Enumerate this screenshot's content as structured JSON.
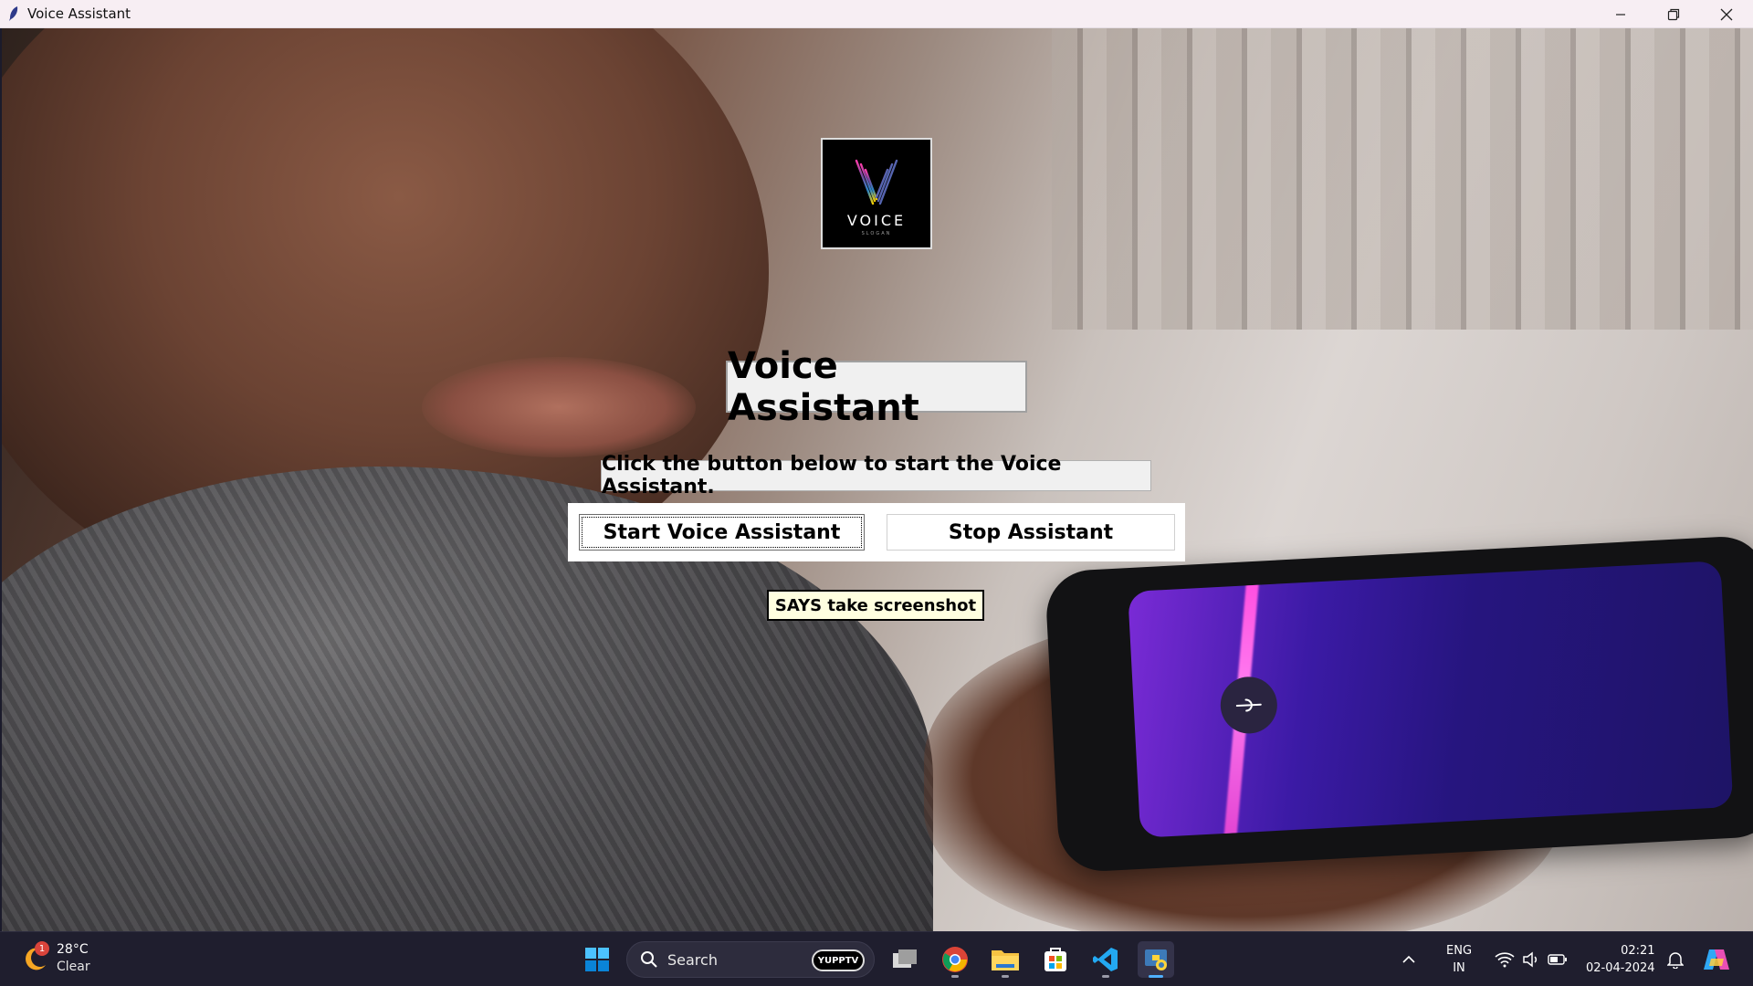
{
  "window": {
    "title": "Voice Assistant",
    "controls": {
      "minimize_icon": "minimize-icon",
      "maximize_icon": "restore-icon",
      "close_icon": "close-icon"
    }
  },
  "logo": {
    "text": "VOICE",
    "subtext": "SLOGAN"
  },
  "main": {
    "heading": "Voice Assistant",
    "instruction": "Click the button below to start the Voice Assistant.",
    "start_button": "Start Voice Assistant",
    "stop_button": "Stop Assistant",
    "status": "SAYS take screenshot"
  },
  "taskbar": {
    "weather": {
      "badge": "1",
      "temperature": "28°C",
      "condition": "Clear"
    },
    "search": {
      "label": "Search",
      "badge": "YUPPTV"
    },
    "apps": [
      {
        "name": "start-button",
        "icon": "windows-icon"
      },
      {
        "name": "task-view",
        "icon": "task-view-icon"
      },
      {
        "name": "chrome",
        "icon": "chrome-icon"
      },
      {
        "name": "file-explorer",
        "icon": "folder-icon"
      },
      {
        "name": "microsoft-store",
        "icon": "store-icon"
      },
      {
        "name": "vscode",
        "icon": "vscode-icon"
      },
      {
        "name": "python-app",
        "icon": "python-icon"
      }
    ],
    "language": {
      "line1": "ENG",
      "line2": "IN"
    },
    "clock": {
      "time": "02:21",
      "date": "02-04-2024"
    }
  },
  "colors": {
    "taskbar_bg": "#1f1e2e",
    "titlebar_bg": "#f7eef3",
    "status_bg": "#ffffe0",
    "phone_screen": "#26157f",
    "phone_wave": "#ff4de0"
  }
}
